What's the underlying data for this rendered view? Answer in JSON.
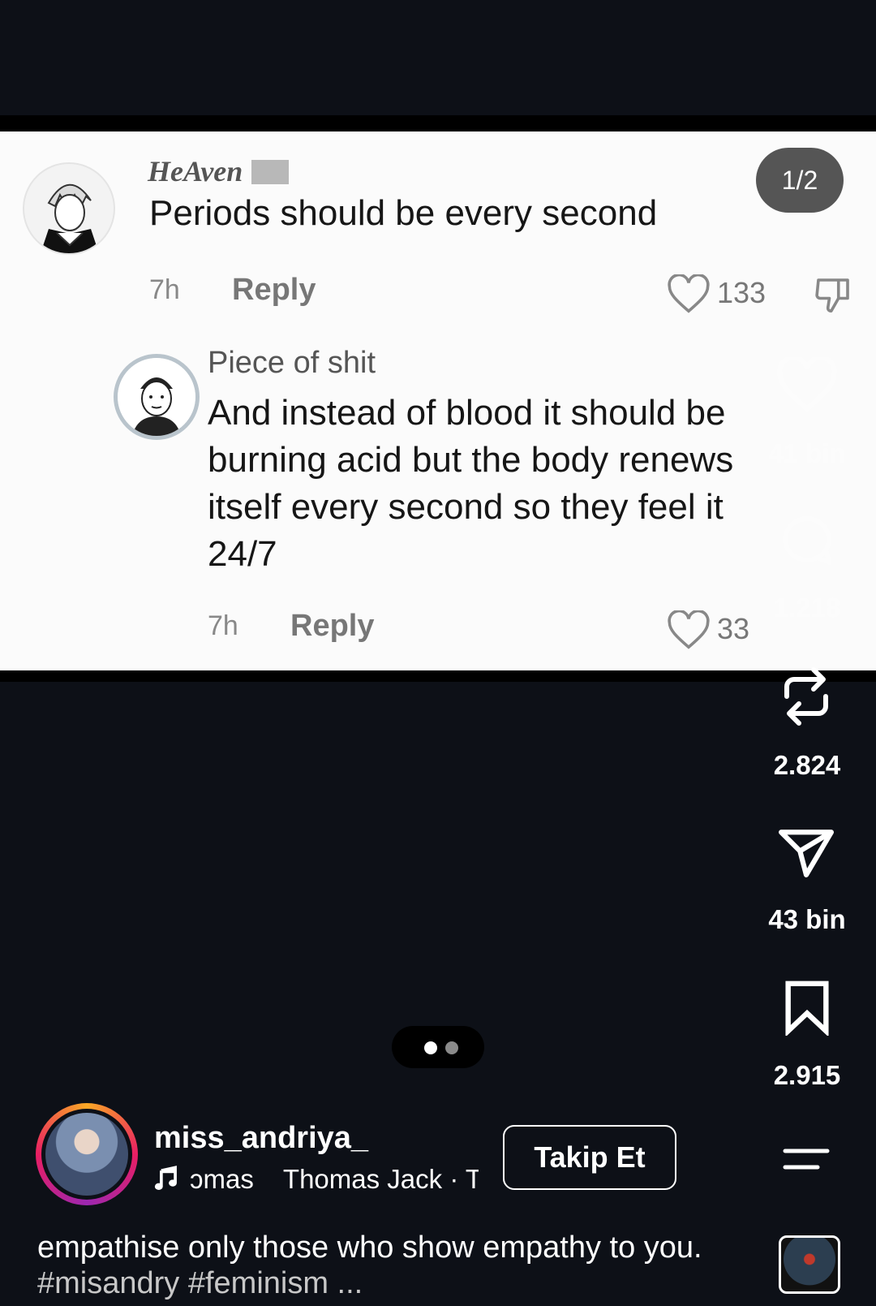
{
  "comments": {
    "pager": "1/2",
    "first": {
      "username": "HeAven",
      "text": "Periods should be every second",
      "time": "7h",
      "reply_label": "Reply",
      "likes": "133"
    },
    "second": {
      "username": "Piece of shit",
      "text": "And instead of blood it should be burning acid but the body renews itself every second so they feel it 24/7",
      "time": "7h",
      "reply_label": "Reply",
      "likes": "33"
    }
  },
  "rail": {
    "like_count": "41 bin",
    "comment_count": "1.218",
    "repost_count": "2.824",
    "share_count": "43 bin",
    "save_count": "2.915"
  },
  "carousel": {
    "active_index": 0,
    "total": 2
  },
  "post": {
    "username": "miss_andriya_",
    "music": "ɔmas    Thomas Jack · T",
    "follow_label": "Takip Et",
    "caption": "empathise only those who show empathy to you.",
    "hashtags": "#misandry #feminism ..."
  },
  "colors": {
    "background": "#0d1017",
    "panel": "#fbfbfb",
    "pager_bg": "#555555"
  },
  "icons": [
    "heart-icon",
    "dislike-icon",
    "comment-icon",
    "repost-icon",
    "share-icon",
    "bookmark-icon",
    "menu-icon",
    "music-icon"
  ]
}
